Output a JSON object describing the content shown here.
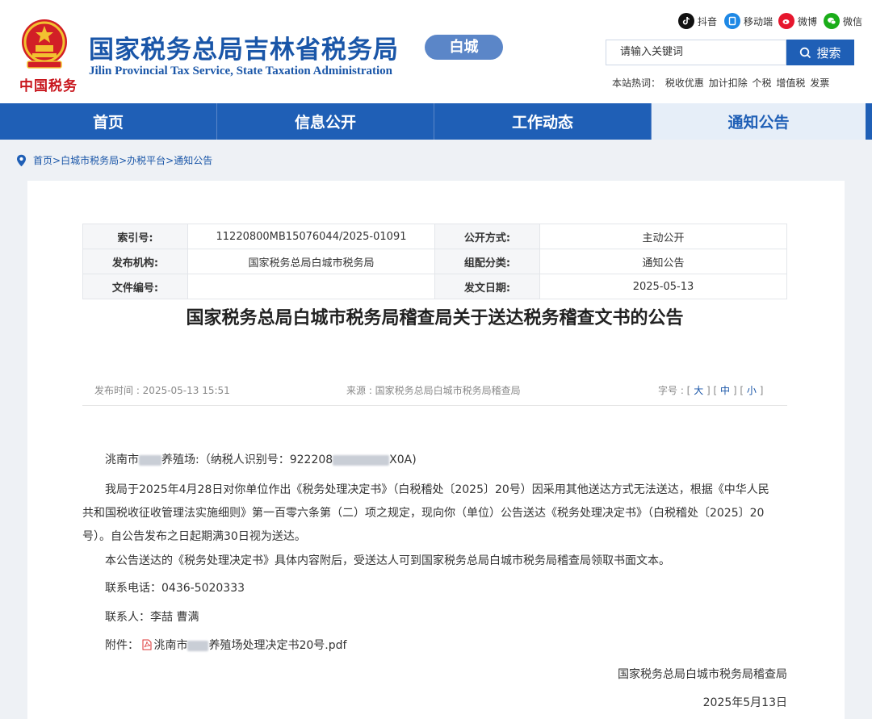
{
  "header": {
    "emblem_text": "中国税务",
    "title": "国家税务总局吉林省税务局",
    "subtitle": "Jilin Provincial Tax Service, State Taxation Administration",
    "city": "白城",
    "social": [
      {
        "label": "抖音",
        "icon": "douyin-icon",
        "color": "#111111"
      },
      {
        "label": "移动端",
        "icon": "mobile-icon",
        "color": "#1e88e5"
      },
      {
        "label": "微博",
        "icon": "weibo-icon",
        "color": "#e6162d"
      },
      {
        "label": "微信",
        "icon": "wechat-icon",
        "color": "#1aad19"
      }
    ],
    "search_value": "请输入关键词",
    "search_button": "搜索",
    "hot_label": "本站热词：",
    "hot_words": [
      "税收优惠",
      "加计扣除",
      "个税",
      "增值税",
      "发票"
    ]
  },
  "nav": {
    "items": [
      {
        "label": "首页",
        "active": false
      },
      {
        "label": "信息公开",
        "active": false
      },
      {
        "label": "工作动态",
        "active": false
      },
      {
        "label": "通知公告",
        "active": true
      }
    ]
  },
  "breadcrumb": {
    "items": [
      "首页",
      "白城市税务局",
      "办税平台",
      "通知公告"
    ],
    "separator": ">"
  },
  "meta": {
    "index_label": "索引号:",
    "index_value": "11220800MB15076044/2025-01091",
    "open_label": "公开方式:",
    "open_value": "主动公开",
    "issuer_label": "发布机构:",
    "issuer_value": "国家税务总局白城市税务局",
    "category_label": "组配分类:",
    "category_value": "通知公告",
    "docno_label": "文件编号:",
    "docno_value": "",
    "date_label": "发文日期:",
    "date_value": "2025-05-13"
  },
  "article": {
    "title": "国家税务总局白城市税务局稽查局关于送达税务稽查文书的公告",
    "publish_time": "发布时间 : 2025-05-13 15:51",
    "source": "来源 : 国家税务总局白城市税务局稽查局",
    "font_size_label": "字号 : [",
    "font_large": "大",
    "font_medium": "中",
    "font_small": "小",
    "para1_pre": "洮南市",
    "para1_mid": "养殖场:（纳税人识别号：922208",
    "para1_post": "X0A)",
    "para2": "我局于2025年4月28日对你单位作出《税务处理决定书》（白税稽处〔2025〕20号）因采用其他送达方式无法送达，根据《中华人民共和国税收征收管理法实施细则》第一百零六条第（二）项之规定，现向你（单位）公告送达《税务处理决定书》（白税稽处〔2025〕20号）。自公告发布之日起期满30日视为送达。",
    "para3": "本公告送达的《税务处理决定书》具体内容附后，受送达人可到国家税务总局白城市税务局稽查局领取书面文本。",
    "phone": "联系电话：0436-5020333",
    "contact": "联系人：李喆  曹满",
    "attach_label": "附件：",
    "attach_pre": "洮南市",
    "attach_post": "养殖场处理决定书20号.pdf",
    "signer": "国家税务总局白城市税务局稽查局",
    "sign_date": "2025年5月13日"
  }
}
